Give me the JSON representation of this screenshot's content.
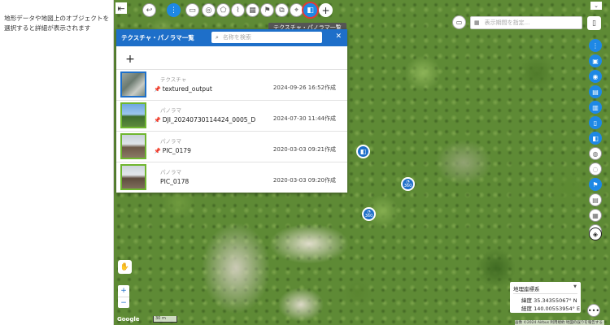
{
  "left_panel": {
    "message": "地形データや地図上のオブジェクトを選択すると詳細が表示されます"
  },
  "toolbar": {
    "tooltip": "テクスチャ・パノラマ一覧",
    "icons": [
      "back-arrow-icon",
      "undo-icon",
      "info-icon",
      "measure-icon",
      "settings-icon",
      "polygon-icon",
      "line-chart-icon",
      "map-icon",
      "flag-icon",
      "copy-icon",
      "location-icon",
      "texture-icon",
      "add-icon"
    ]
  },
  "date_search": {
    "placeholder": "表示期間を指定..."
  },
  "panel": {
    "title": "テクスチャ・パノラマ一覧",
    "search_placeholder": "名称を検索",
    "close_label": "✕",
    "add_label": "+",
    "items": [
      {
        "kind": "テクスチャ",
        "name": "textured_output",
        "pinned": true,
        "date": "2024-09-26 16:52作成"
      },
      {
        "kind": "パノラマ",
        "name": "DJI_20240730114424_0005_D",
        "pinned": true,
        "date": "2024-07-30 11:44作成"
      },
      {
        "kind": "パノラマ",
        "name": "PIC_0179",
        "pinned": true,
        "date": "2020-03-03 09:21作成"
      },
      {
        "kind": "パノラマ",
        "name": "PIC_0178",
        "pinned": false,
        "date": "2020-03-03 09:20作成"
      }
    ]
  },
  "markers": {
    "label_360": "360"
  },
  "coordinates": {
    "system": "地理座標系",
    "lat": "緯度  35.34355067° N",
    "lon": "経度  140.00553954° E"
  },
  "map_footer": {
    "google": "Google",
    "scale": "30 m",
    "attribution": "画像 ©2024 Airbus  利用規約  地図の誤りを報告する"
  },
  "colors": {
    "accent": "#1e6fc9",
    "selected_ring": "#e53935",
    "thumb_border": "#6fb62f"
  }
}
